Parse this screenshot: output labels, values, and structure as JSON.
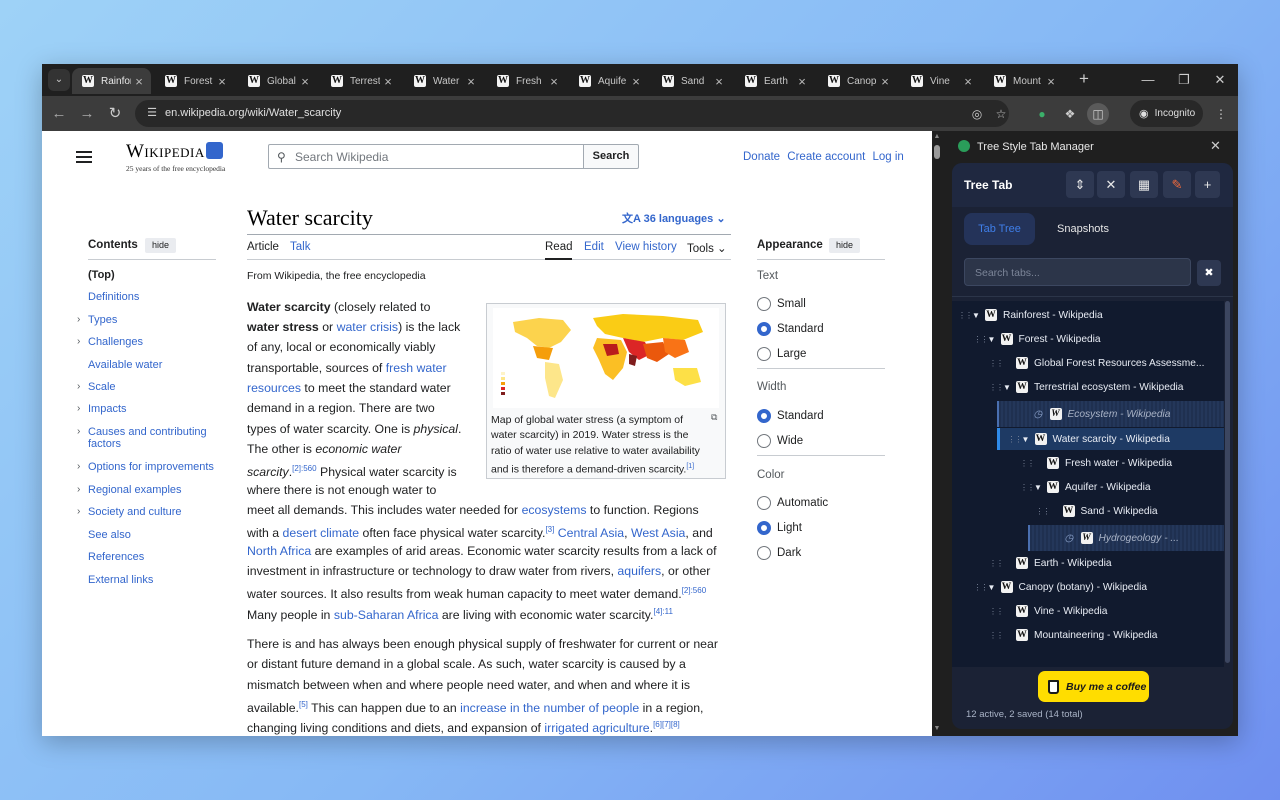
{
  "browser": {
    "tabs": [
      {
        "title": "Rainfore",
        "active": true
      },
      {
        "title": "Forest"
      },
      {
        "title": "Global"
      },
      {
        "title": "Terrest"
      },
      {
        "title": "Water",
        "active": false
      },
      {
        "title": "Fresh"
      },
      {
        "title": "Aquife"
      },
      {
        "title": "Sand"
      },
      {
        "title": "Earth"
      },
      {
        "title": "Canop"
      },
      {
        "title": "Vine"
      },
      {
        "title": "Mount"
      }
    ],
    "url": "en.wikipedia.org/wiki/Water_scarcity",
    "incognito_label": "Incognito"
  },
  "wiki": {
    "logo_wordmark": "Wikipedia",
    "logo_tagline": "25 years of the free encyclopedia",
    "search_placeholder": "Search Wikipedia",
    "search_button": "Search",
    "top_links": [
      "Donate",
      "Create account",
      "Log in"
    ],
    "contents_heading": "Contents",
    "hide_label": "hide",
    "toc": [
      {
        "label": "(Top)",
        "expandable": false
      },
      {
        "label": "Definitions",
        "expandable": false
      },
      {
        "label": "Types",
        "expandable": true
      },
      {
        "label": "Challenges",
        "expandable": true
      },
      {
        "label": "Available water",
        "expandable": false
      },
      {
        "label": "Scale",
        "expandable": true
      },
      {
        "label": "Impacts",
        "expandable": true
      },
      {
        "label": "Causes and contributing",
        "label2": "factors",
        "expandable": true
      },
      {
        "label": "Options for improvements",
        "expandable": true
      },
      {
        "label": "Regional examples",
        "expandable": true
      },
      {
        "label": "Society and culture",
        "expandable": true
      },
      {
        "label": "See also",
        "expandable": false
      },
      {
        "label": "References",
        "expandable": false
      },
      {
        "label": "External links",
        "expandable": false
      }
    ],
    "title": "Water scarcity",
    "languages": "36 languages",
    "tab_article": "Article",
    "tab_talk": "Talk",
    "tab_read": "Read",
    "tab_edit": "Edit",
    "tab_history": "View history",
    "tab_tools": "Tools",
    "from_line": "From Wikipedia, the free encyclopedia",
    "figure_caption": [
      "Map of global water stress (a symptom of",
      "water scarcity) in 2019. Water stress is the",
      "ratio of water use relative to water availability",
      "and is therefore a demand-driven scarcity."
    ],
    "figure_cite": "[1]",
    "appearance_heading": "Appearance",
    "text_heading": "Text",
    "text_options": [
      "Small",
      "Standard",
      "Large"
    ],
    "text_selected": "Standard",
    "width_heading": "Width",
    "width_options": [
      "Standard",
      "Wide"
    ],
    "width_selected": "Standard",
    "color_heading": "Color",
    "color_options": [
      "Automatic",
      "Light",
      "Dark"
    ],
    "color_selected": "Light",
    "p1": {
      "l1a": "Water scarcity",
      "l1b": " (closely related to",
      "l2a": "water stress",
      "l2b": " or ",
      "l2c": "water crisis",
      "l2d": ") is the lack",
      "l3": "of any, local or economically viably",
      "l4a": "transportable, sources of ",
      "l4b": "fresh water",
      "l5a": "resources",
      "l5b": " to meet the standard water",
      "l6": "demand in a region. There are two",
      "l7a": "types of water scarcity. One is ",
      "l7b": "physical",
      "l8a": "The other is ",
      "l8b": "economic water",
      "l9a": "scarcity",
      "l9b": "[2]:560",
      "l9c": " Physical water scarcity is",
      "l10": "where there is not enough water to",
      "l11a": "meet all demands. This includes water needed for ",
      "l11b": "ecosystems",
      "l11c": " to function. Regions",
      "l12a": "with a ",
      "l12b": "desert climate",
      "l12c": " often face physical water scarcity.",
      "l12d": "[3]",
      "l12e": "Central Asia",
      "l12f": "West Asia",
      "l12g": ", and",
      "l13a": "North Africa",
      "l13b": " are examples of arid areas. Economic water scarcity results from a lack of",
      "l14a": "investment in infrastructure or technology to draw water from rivers, ",
      "l14b": "aquifers",
      "l14c": ", or other",
      "l15a": "water sources. It also results from weak human capacity to meet water demand.",
      "l15b": "[2]:560",
      "l16a": "Many people in ",
      "l16b": "sub-Saharan Africa",
      "l16c": " are living with economic water scarcity.",
      "l16d": "[4]:11"
    },
    "p2": {
      "l1": "There is and has always been enough physical supply of freshwater for current or near",
      "l2": "or distant future demand in a global scale. As such, water scarcity is caused by a",
      "l3": "mismatch between when and where people need water, and when and where it is",
      "l4a": "available.",
      "l4b": "[5]",
      "l4c": " This can happen due to an ",
      "l4d": "increase in the number of people",
      "l4e": " in a region,",
      "l5a": "changing living conditions and diets, and expansion of ",
      "l5b": "irrigated agriculture",
      "l5c": ".",
      "l5d": "[6][7][8]"
    }
  },
  "panel": {
    "title": "Tree Style Tab Manager",
    "app_title": "Tree Tab",
    "seg_tree": "Tab Tree",
    "seg_snap": "Snapshots",
    "search_placeholder": "Search tabs...",
    "buy_coffee": "Buy me a coffee",
    "status": "12 active, 2 saved (14 total)",
    "tree": [
      {
        "title": "Rainforest - Wikipedia",
        "depth": 0,
        "twisty": "open",
        "state": "normal"
      },
      {
        "title": "Forest - Wikipedia",
        "depth": 1,
        "twisty": "open",
        "state": "normal"
      },
      {
        "title": "Global Forest Resources Assessme...",
        "depth": 2,
        "twisty": "none",
        "state": "normal"
      },
      {
        "title": "Terrestrial ecosystem - Wikipedia",
        "depth": 2,
        "twisty": "open",
        "state": "normal"
      },
      {
        "title": "Ecosystem - Wikipedia",
        "depth": 3,
        "twisty": "none",
        "state": "saved"
      },
      {
        "title": "Water scarcity - Wikipedia",
        "depth": 3,
        "twisty": "open",
        "state": "current"
      },
      {
        "title": "Fresh water - Wikipedia",
        "depth": 4,
        "twisty": "none",
        "state": "normal"
      },
      {
        "title": "Aquifer - Wikipedia",
        "depth": 4,
        "twisty": "open",
        "state": "normal"
      },
      {
        "title": "Sand - Wikipedia",
        "depth": 5,
        "twisty": "none",
        "state": "normal"
      },
      {
        "title": "Hydrogeology - ...",
        "depth": 5,
        "twisty": "none",
        "state": "saved"
      },
      {
        "title": "Earth - Wikipedia",
        "depth": 2,
        "twisty": "none",
        "state": "normal"
      },
      {
        "title": "Canopy (botany) - Wikipedia",
        "depth": 1,
        "twisty": "open",
        "state": "normal"
      },
      {
        "title": "Vine - Wikipedia",
        "depth": 2,
        "twisty": "none",
        "state": "normal"
      },
      {
        "title": "Mountaineering - Wikipedia",
        "depth": 2,
        "twisty": "none",
        "state": "normal"
      }
    ]
  },
  "colors": {
    "link": "#3366cc",
    "panel_bg": "#1b2235",
    "accent_blue": "#2f8ae8",
    "coffee_yellow": "#ffdd00"
  }
}
